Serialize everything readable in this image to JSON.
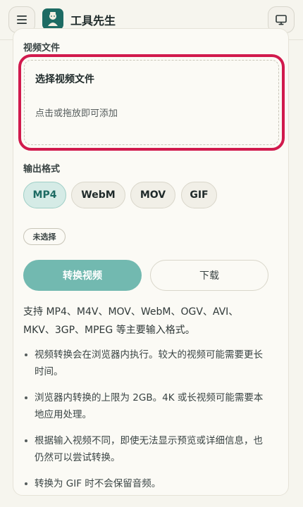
{
  "header": {
    "app_name": "工具先生",
    "menu_icon": "hamburger-menu-icon",
    "logo_icon": "mascot-logo-icon",
    "display_icon": "monitor-icon"
  },
  "video_file": {
    "label": "视频文件",
    "dropzone_title": "选择视频文件",
    "dropzone_hint": "点击或拖放即可添加"
  },
  "output": {
    "label": "输出格式",
    "formats": [
      "MP4",
      "WebM",
      "MOV",
      "GIF"
    ],
    "selected": "MP4",
    "status_badge": "未选择"
  },
  "actions": {
    "convert_label": "转换视频",
    "download_label": "下载"
  },
  "description": "支持 MP4、M4V、MOV、WebM、OGV、AVI、MKV、3GP、MPEG 等主要输入格式。",
  "notes": [
    "视频转换会在浏览器内执行。较大的视频可能需要更长时间。",
    "浏览器内转换的上限为 2GB。4K 或长视频可能需要本地应用处理。",
    "根据输入视频不同，即使无法显示预览或详细信息，也仍然可以尝试转换。",
    "转换为 GIF 时不会保留音频。"
  ],
  "colors": {
    "accent": "#1d6b63",
    "highlight_border": "#d11a4d",
    "convert_button": "#72b9b0"
  }
}
